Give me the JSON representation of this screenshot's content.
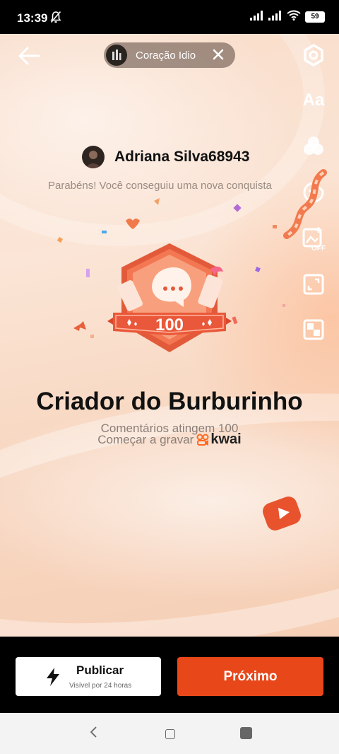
{
  "status": {
    "time": "13:39",
    "battery": "59"
  },
  "chip": {
    "title": "Coração Idio"
  },
  "tools": {
    "text_label": "Aa",
    "sticker_off_label": "OFF"
  },
  "user": {
    "name": "Adriana Silva68943"
  },
  "congrats": "Parabéns! Você conseguiu uma nova conquista",
  "badge": {
    "number": "100",
    "title": "Criador do Burburinho",
    "subtitle": "Comentários atingem 100",
    "cta": "Começar a gravar",
    "brand": "kwai"
  },
  "buttons": {
    "publish_label": "Publicar",
    "publish_sub": "Visível por 24 horas",
    "next_label": "Próximo"
  },
  "colors": {
    "accent": "#e8471a",
    "badge": "#e25a3a"
  }
}
